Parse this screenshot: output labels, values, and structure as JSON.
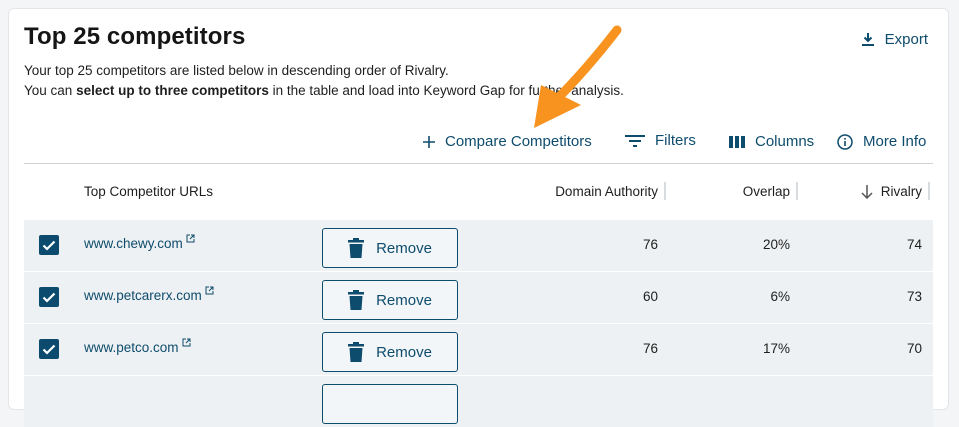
{
  "header": {
    "title": "Top 25 competitors",
    "export_label": "Export",
    "desc_line1": "Your top 25 competitors are listed below in descending order of Rivalry.",
    "desc_line2_pre": "You can ",
    "desc_line2_bold": "select up to three competitors",
    "desc_line2_post": " in the table and load into Keyword Gap for further analysis."
  },
  "toolbar": {
    "compare_label": "Compare Competitors",
    "filters_label": "Filters",
    "columns_label": "Columns",
    "more_info_label": "More Info"
  },
  "table": {
    "columns": [
      "Top Competitor URLs",
      "Domain Authority",
      "Overlap",
      "Rivalry"
    ],
    "sort_column": "Rivalry",
    "sort_direction": "descending",
    "remove_label": "Remove",
    "rows": [
      {
        "url": "www.chewy.com",
        "checked": true,
        "domain_authority": "76",
        "overlap": "20%",
        "rivalry": "74"
      },
      {
        "url": "www.petcarerx.com",
        "checked": true,
        "domain_authority": "60",
        "overlap": "6%",
        "rivalry": "73"
      },
      {
        "url": "www.petco.com",
        "checked": true,
        "domain_authority": "76",
        "overlap": "17%",
        "rivalry": "70"
      }
    ]
  },
  "colors": {
    "accent": "#0e4c6d",
    "row_background": "#eef1f3",
    "annotation_arrow": "#f7931e"
  },
  "icons": [
    "download-icon",
    "plus-icon",
    "filter-icon",
    "columns-icon",
    "info-icon",
    "sort-down-arrow-icon",
    "checkbox-checked-icon",
    "external-link-icon",
    "trash-icon",
    "annotation-arrow"
  ]
}
